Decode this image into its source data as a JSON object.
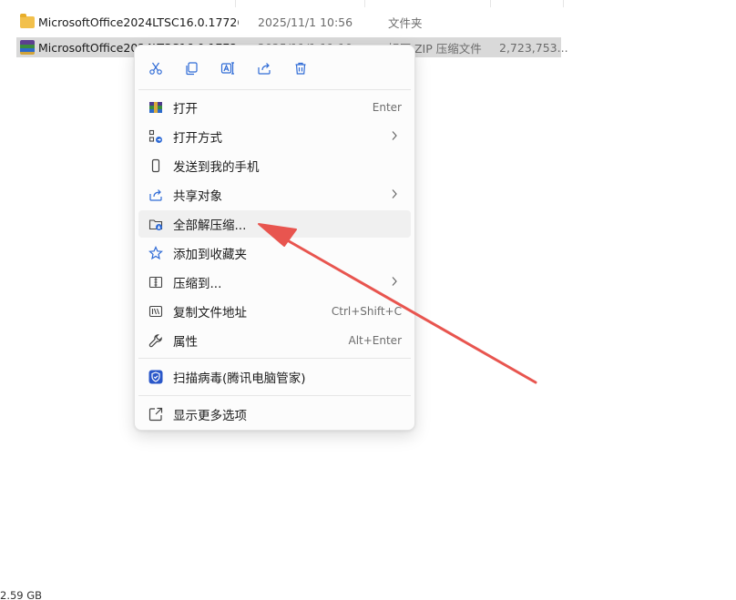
{
  "files": [
    {
      "name": "MicrosoftOffice2024LTSC16.0.17726....",
      "date": "2025/11/1 10:56",
      "type": "文件夹",
      "size": "",
      "icon": "folder-icon",
      "selected": false
    },
    {
      "name": "MicrosoftOffice2024LTSC16.0.17726....",
      "date": "2025/11/1 11:19",
      "type": "好压 ZIP 压缩文件",
      "size": "2,723,753...",
      "icon": "zip-archive-icon",
      "selected": true
    }
  ],
  "status": {
    "free_space": "2.59 GB"
  },
  "context_menu": {
    "quick_actions": [
      {
        "name": "cut",
        "icon": "scissors-icon"
      },
      {
        "name": "copy",
        "icon": "copy-icon"
      },
      {
        "name": "rename",
        "icon": "rename-icon"
      },
      {
        "name": "share",
        "icon": "share-icon"
      },
      {
        "name": "delete",
        "icon": "trash-icon"
      }
    ],
    "items": [
      {
        "label": "打开",
        "shortcut": "Enter",
        "icon": "archive-open-icon"
      },
      {
        "label": "打开方式",
        "shortcut": "",
        "icon": "open-with-icon",
        "submenu": true
      },
      {
        "label": "发送到我的手机",
        "shortcut": "",
        "icon": "phone-icon"
      },
      {
        "label": "共享对象",
        "shortcut": "",
        "icon": "share-icon",
        "submenu": true
      },
      {
        "label": "全部解压缩...",
        "shortcut": "",
        "icon": "extract-all-icon",
        "highlighted": true
      },
      {
        "label": "添加到收藏夹",
        "shortcut": "",
        "icon": "star-icon"
      },
      {
        "label": "压缩到...",
        "shortcut": "",
        "icon": "compress-icon",
        "submenu": true
      },
      {
        "label": "复制文件地址",
        "shortcut": "Ctrl+Shift+C",
        "icon": "copy-path-icon"
      },
      {
        "label": "属性",
        "shortcut": "Alt+Enter",
        "icon": "wrench-icon"
      },
      {
        "label": "扫描病毒(腾讯电脑管家)",
        "shortcut": "",
        "icon": "shield-scan-icon"
      },
      {
        "label": "显示更多选项",
        "shortcut": "",
        "icon": "show-more-icon"
      }
    ]
  },
  "colors": {
    "annotation_arrow": "#e8554f",
    "selection": "#d9d9d9",
    "accent": "#1a73e8"
  }
}
